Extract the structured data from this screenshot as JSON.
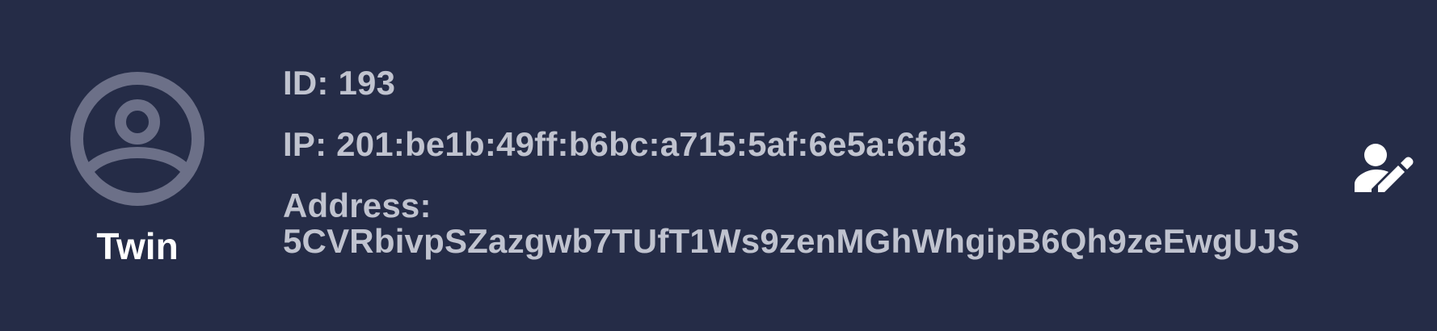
{
  "profile": {
    "name": "Twin",
    "avatar_icon": "account-circle-icon",
    "id_text": "ID: 193",
    "ip_text": "IP: 201:be1b:49ff:b6bc:a715:5af:6e5a:6fd3",
    "address_label": "Address:",
    "address_value": "5CVRbivpSZazgwb7TUfT1Ws9zenMGhWhgipB6Qh9zeEwgUJS"
  },
  "actions": {
    "edit_icon": "user-edit-icon"
  },
  "colors": {
    "background": "#252c47",
    "text_primary": "#ffffff",
    "text_secondary": "#c0c3cf",
    "avatar": "#6c7088"
  }
}
